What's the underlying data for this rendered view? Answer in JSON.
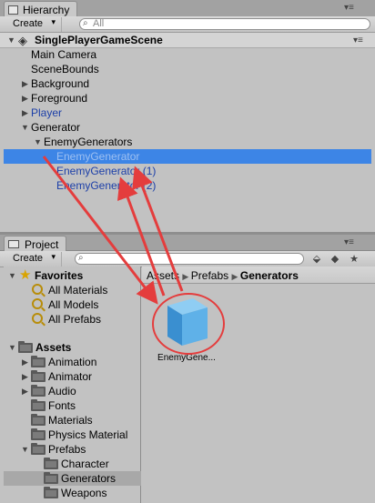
{
  "hierarchy": {
    "tab_label": "Hierarchy",
    "create_label": "Create",
    "search_placeholder": "All",
    "scene_name": "SinglePlayerGameScene",
    "items": [
      {
        "label": "Main Camera",
        "color": "#000000"
      },
      {
        "label": "SceneBounds",
        "color": "#000000"
      },
      {
        "label": "Background",
        "color": "#000000"
      },
      {
        "label": "Foreground",
        "color": "#000000"
      },
      {
        "label": "Player",
        "color": "#1c3fa8"
      },
      {
        "label": "Generator",
        "color": "#000000"
      },
      {
        "label": "EnemyGenerators",
        "color": "#000000"
      },
      {
        "label": "EnemyGenerator",
        "color": "#9dc0f2",
        "selected": true
      },
      {
        "label": "EnemyGenerator (1)",
        "color": "#1c3fa8"
      },
      {
        "label": "EnemyGenerator (2)",
        "color": "#1c3fa8"
      }
    ]
  },
  "project": {
    "tab_label": "Project",
    "create_label": "Create",
    "breadcrumb": {
      "root": "Assets",
      "mid": "Prefabs",
      "current": "Generators"
    },
    "favorites": {
      "label": "Favorites",
      "items": [
        "All Materials",
        "All Models",
        "All Prefabs"
      ]
    },
    "assets": {
      "label": "Assets",
      "folders": [
        "Animation",
        "Animator",
        "Audio",
        "Fonts",
        "Materials",
        "Physics Material",
        "Prefabs"
      ],
      "prefab_children": [
        "Character",
        "Generators",
        "Weapons"
      ],
      "selected_child": "Generators"
    },
    "asset_item": {
      "label": "EnemyGene...",
      "icon": "prefab-cube-icon"
    }
  },
  "colors": {
    "selection": "#3d85e6",
    "annotation_red": "#e43d3d",
    "prefab_blue": "#1c3fa8"
  }
}
